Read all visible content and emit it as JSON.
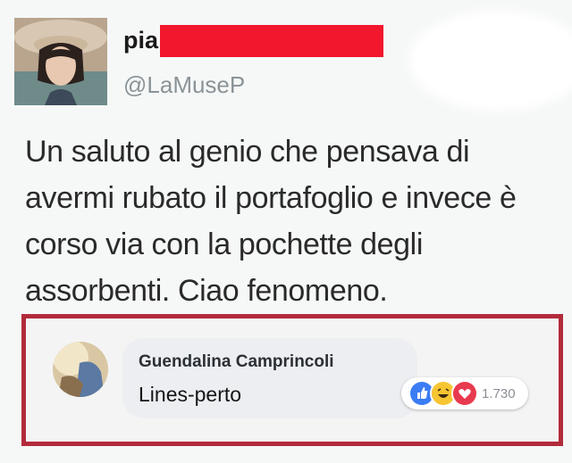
{
  "post": {
    "display_name": "pia",
    "handle": "@LaMuseP",
    "text": "Un saluto al genio che pensava di avermi rubato il portafoglio e invece è corso via con la pochette degli assorbenti. Ciao fenomeno."
  },
  "comment": {
    "author": "Guendalina Camprincoli",
    "text": "Lines-perto",
    "reaction_count": "1.730",
    "reactions": [
      "like-icon",
      "haha-icon",
      "love-icon"
    ]
  },
  "colors": {
    "redaction": "#f2172c",
    "highlight_border": "#b32b3b",
    "like": "#3b7cf5",
    "haha": "#f7c531",
    "love": "#e83a4e"
  }
}
